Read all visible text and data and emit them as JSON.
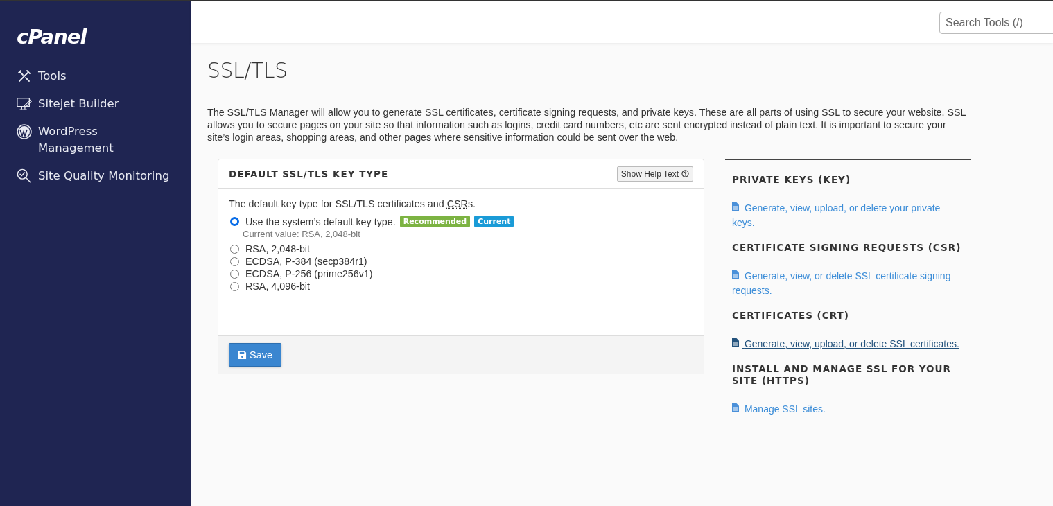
{
  "sidebar": {
    "logo": "cPanel",
    "items": [
      {
        "label": "Tools"
      },
      {
        "label": "Sitejet Builder"
      },
      {
        "label": "WordPress Management"
      },
      {
        "label": "Site Quality Monitoring"
      }
    ]
  },
  "header": {
    "search": {
      "placeholder": "Search Tools (/)"
    }
  },
  "page": {
    "title": "SSL/TLS",
    "description": "The SSL/TLS Manager will allow you to generate SSL certificates, certificate signing requests, and private keys. These are all parts of using SSL to secure your website. SSL allows you to secure pages on your site so that information such as logins, credit card numbers, etc are sent encrypted instead of plain text. It is important to secure your site’s login areas, shopping areas, and other pages where sensitive information could be sent over the web."
  },
  "key_type_panel": {
    "title": "DEFAULT SSL/TLS KEY TYPE",
    "help_button": "Show Help Text",
    "intro": "The default key type for SSL/TLS certificates and",
    "intro_abbr": "CSR",
    "intro_end": "s.",
    "options": [
      {
        "label": "Use the system’s default key type.",
        "selected": true,
        "badges": [
          {
            "text": "Recommended",
            "color": "#7cb342"
          },
          {
            "text": "Current",
            "color": "#1a9bd7"
          }
        ],
        "note": "Current value: RSA, 2,048-bit"
      },
      {
        "label": "RSA, 2,048-bit",
        "selected": false
      },
      {
        "label": "ECDSA, P-384 (secp384r1)",
        "selected": false
      },
      {
        "label": "ECDSA, P-256 (prime256v1)",
        "selected": false
      },
      {
        "label": "RSA, 4,096-bit",
        "selected": false
      }
    ],
    "save_button": "Save"
  },
  "sections": [
    {
      "heading": "PRIVATE KEYS (KEY)",
      "link": "Generate, view, upload, or delete your private keys.",
      "hovered": false
    },
    {
      "heading": "CERTIFICATE SIGNING REQUESTS (CSR)",
      "link": "Generate, view, or delete SSL certificate signing requests.",
      "hovered": false
    },
    {
      "heading": "CERTIFICATES (CRT)",
      "link": "Generate, view, upload, or delete SSL certificates.",
      "hovered": true
    },
    {
      "heading": "INSTALL AND MANAGE SSL FOR YOUR SITE (HTTPS)",
      "link": "Manage SSL sites.",
      "hovered": false
    }
  ]
}
